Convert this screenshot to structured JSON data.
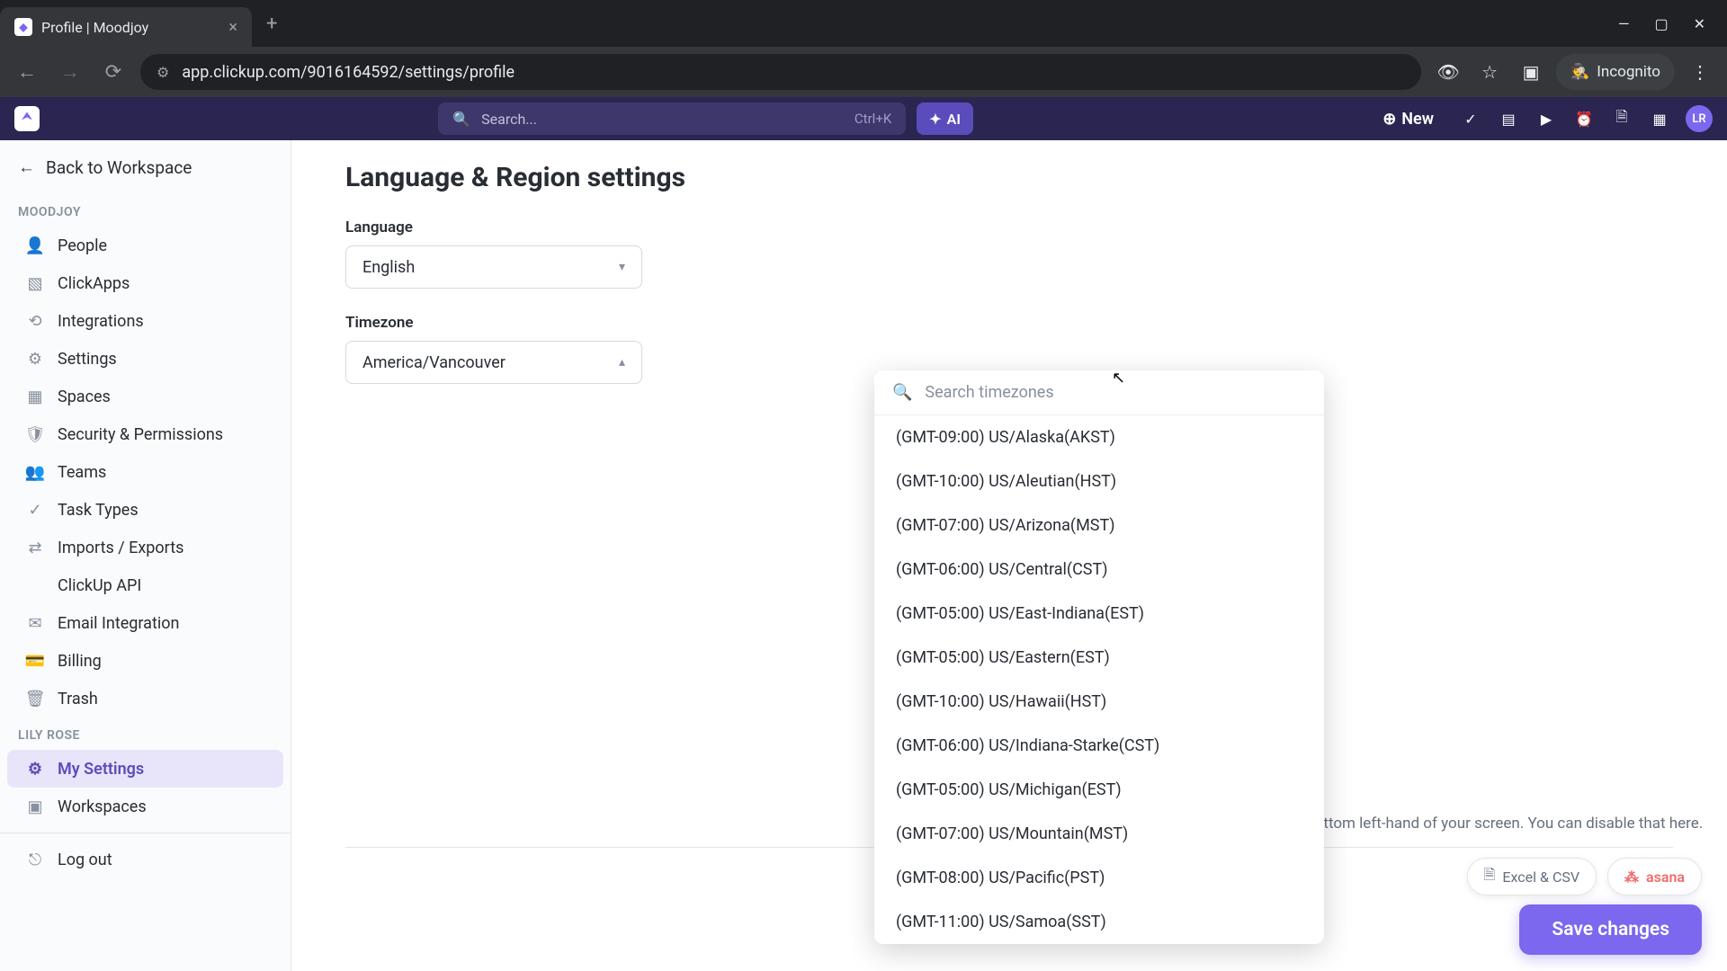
{
  "browser": {
    "tab_title": "Profile | Moodjoy",
    "url": "app.clickup.com/9016164592/settings/profile",
    "incognito": "Incognito"
  },
  "header": {
    "search_placeholder": "Search...",
    "shortcut": "Ctrl+K",
    "ai_label": "AI",
    "new_label": "New",
    "avatar": "LR"
  },
  "sidebar": {
    "back": "Back to Workspace",
    "section1": "MOODJOY",
    "items1": [
      "People",
      "ClickApps",
      "Integrations",
      "Settings",
      "Spaces",
      "Security & Permissions",
      "Teams",
      "Task Types",
      "Imports / Exports",
      "ClickUp API",
      "Email Integration",
      "Billing",
      "Trash"
    ],
    "section2": "LILY ROSE",
    "items2": [
      "My Settings",
      "Workspaces"
    ],
    "logout": "Log out"
  },
  "page": {
    "title": "Language & Region settings",
    "language_label": "Language",
    "language_value": "English",
    "timezone_label": "Timezone",
    "timezone_value": "America/Vancouver",
    "search_tz_placeholder": "Search timezones",
    "timezones": [
      "(GMT-09:00) US/Alaska(AKST)",
      "(GMT-10:00) US/Aleutian(HST)",
      "(GMT-07:00) US/Arizona(MST)",
      "(GMT-06:00) US/Central(CST)",
      "(GMT-05:00) US/East-Indiana(EST)",
      "(GMT-05:00) US/Eastern(EST)",
      "(GMT-10:00) US/Hawaii(HST)",
      "(GMT-06:00) US/Indiana-Starke(CST)",
      "(GMT-05:00) US/Michigan(EST)",
      "(GMT-07:00) US/Mountain(MST)",
      "(GMT-08:00) US/Pacific(PST)",
      "(GMT-11:00) US/Samoa(SST)"
    ],
    "helper": "the bottom left-hand of your screen. You can disable that here.",
    "excel_badge": "Excel & CSV",
    "asana_badge": "asana",
    "save": "Save changes"
  }
}
